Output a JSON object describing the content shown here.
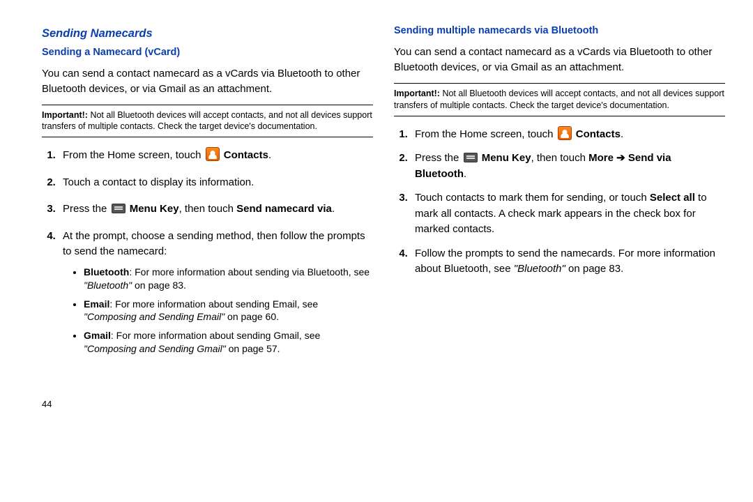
{
  "pageNumber": "44",
  "left": {
    "sectionTitle": "Sending Namecards",
    "subTitle": "Sending a Namecard (vCard)",
    "intro": "You can send a contact namecard as a vCards via Bluetooth to other Bluetooth devices, or via Gmail as an attachment.",
    "notice": {
      "label": "Important!:",
      "text": " Not all Bluetooth devices will accept contacts, and not all devices support transfers of multiple contacts. Check the target device's documentation."
    },
    "steps": {
      "s1a": "From the Home screen, touch ",
      "s1b": "Contacts",
      "s1c": ".",
      "s2": "Touch a contact to display its information.",
      "s3a": "Press the ",
      "s3b": "Menu Key",
      "s3c": ", then touch ",
      "s3d": "Send namecard via",
      "s3e": ".",
      "s4": "At the prompt, choose a sending method, then follow the prompts to send the namecard:"
    },
    "bullets": {
      "b1_label": "Bluetooth",
      "b1_text": ": For more information about sending via Bluetooth, see ",
      "b1_ref": "\"Bluetooth\"",
      "b1_tail": " on page 83.",
      "b2_label": "Email",
      "b2_text": ": For more information about sending Email, see ",
      "b2_ref": "\"Composing and Sending Email\"",
      "b2_tail": " on page 60.",
      "b3_label": "Gmail",
      "b3_text": ": For more information about sending Gmail, see ",
      "b3_ref": "\"Composing and Sending Gmail\"",
      "b3_tail": " on page 57."
    }
  },
  "right": {
    "subTitle": "Sending multiple namecards via Bluetooth",
    "intro": "You can send a contact namecard as a vCards via Bluetooth to other Bluetooth devices, or via Gmail as an attachment.",
    "notice": {
      "label": "Important!:",
      "text": " Not all Bluetooth devices will accept contacts, and not all devices support transfers of multiple contacts. Check the target device's documentation."
    },
    "steps": {
      "s1a": "From the Home screen, touch ",
      "s1b": "Contacts",
      "s1c": ".",
      "s2a": "Press the ",
      "s2b": "Menu Key",
      "s2c": ", then touch ",
      "s2d": "More",
      "s2arrow": " ➔ ",
      "s2e": "Send via Bluetooth",
      "s2f": ".",
      "s3a": "Touch contacts to mark them for sending, or touch ",
      "s3b": "Select all",
      "s3c": " to mark all contacts. A check mark appears in the check box for marked contacts.",
      "s4a": "Follow the prompts to send the namecards. For more information about Bluetooth, see ",
      "s4ref": "\"Bluetooth\"",
      "s4b": " on page 83."
    }
  }
}
